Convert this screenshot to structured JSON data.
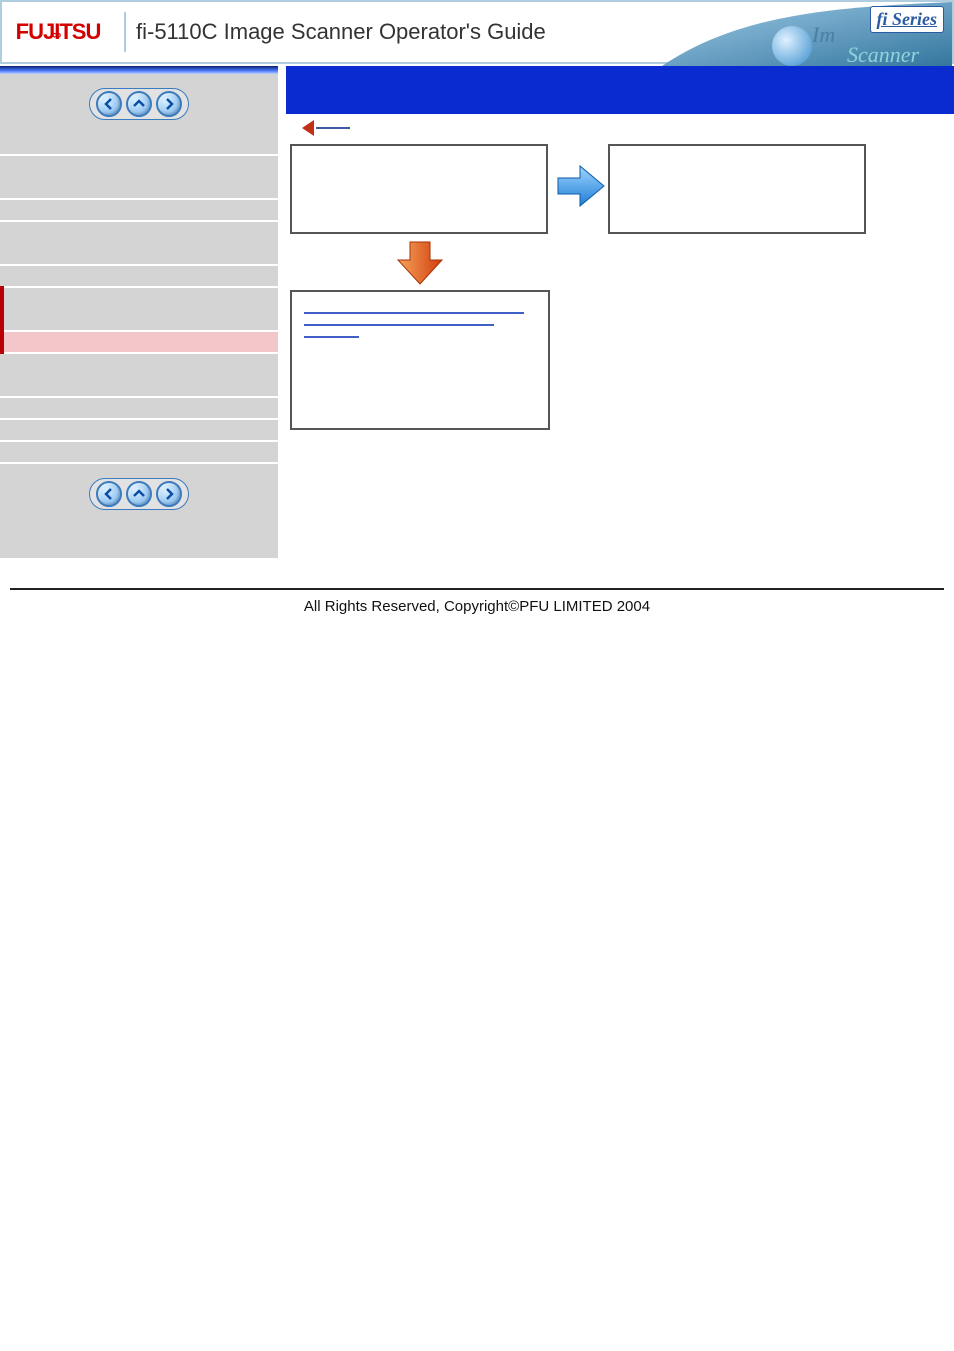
{
  "header": {
    "logo_text": "FUJITSU",
    "title": "fi-5110C   Image Scanner Operator's Guide",
    "badge_text": "fi Series",
    "scanner_word": "Scanner"
  },
  "nav": {
    "prev_title": "Previous",
    "up_title": "Up",
    "next_title": "Next"
  },
  "sidebar": {
    "items": [
      {
        "id": "item-1",
        "cls": "sidebar-item",
        "label": ""
      },
      {
        "id": "item-2",
        "cls": "sidebar-item taller",
        "label": ""
      },
      {
        "id": "item-3",
        "cls": "sidebar-item",
        "label": ""
      },
      {
        "id": "item-4",
        "cls": "sidebar-item taller",
        "label": ""
      },
      {
        "id": "item-5",
        "cls": "sidebar-item",
        "label": ""
      },
      {
        "id": "item-6",
        "cls": "sidebar-item taller left-accent",
        "label": ""
      },
      {
        "id": "item-7",
        "cls": "sidebar-item active left-accent",
        "label": ""
      },
      {
        "id": "item-8",
        "cls": "sidebar-item taller",
        "label": ""
      },
      {
        "id": "item-9",
        "cls": "sidebar-item",
        "label": ""
      },
      {
        "id": "item-10",
        "cls": "sidebar-item",
        "label": ""
      },
      {
        "id": "item-11",
        "cls": "sidebar-item",
        "label": ""
      }
    ]
  },
  "main": {
    "heading": "",
    "back_label": "",
    "box_a_text": "",
    "box_b_text": "",
    "box_c_links": [
      "",
      "",
      ""
    ]
  },
  "footer": {
    "text": "All Rights Reserved,  Copyright©PFU LIMITED 2004"
  },
  "colors": {
    "accent_blue": "#0a2bd0",
    "sidebar_grey": "#d4d4d4",
    "active_pink": "#f3c6c9",
    "link_blue": "#4060c8",
    "arrow_orange": "#e8611c",
    "arrow_blue": "#3aa0f0"
  }
}
